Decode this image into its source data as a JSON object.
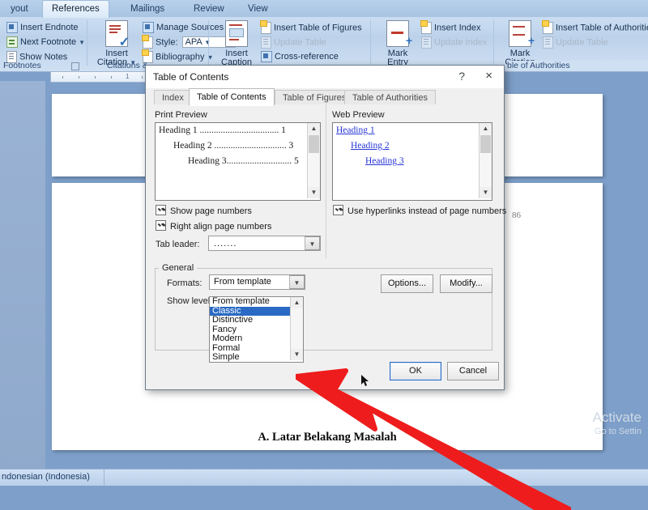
{
  "ribbon": {
    "tabs": [
      {
        "label": "yout",
        "active": false
      },
      {
        "label": "References",
        "active": true
      },
      {
        "label": "Mailings",
        "active": false
      },
      {
        "label": "Review",
        "active": false
      },
      {
        "label": "View",
        "active": false
      }
    ],
    "groups": [
      {
        "name": "Footnotes",
        "label": "Footnotes",
        "items": [
          "Insert Endnote",
          "Next Footnote",
          "Show Notes"
        ]
      },
      {
        "name": "Citations & Bibliography",
        "label": "Citations &",
        "big": "Insert\nCitation",
        "big_line1": "Insert",
        "big_line2": "Citation",
        "items": [
          "Manage Sources",
          "Style:",
          "Bibliography"
        ],
        "style_value": "APA"
      },
      {
        "name": "Captions",
        "label": "",
        "big_line1": "Insert",
        "big_line2": "Caption",
        "items": [
          "Insert Table of Figures",
          "Update Table",
          "Cross-reference"
        ]
      },
      {
        "name": "Index",
        "label": "",
        "big_line1": "Mark",
        "big_line2": "Entry",
        "items": [
          "Insert Index",
          "Update Index"
        ]
      },
      {
        "name": "Table of Authorities",
        "label": "ble of Authorities",
        "big_line1": "Mark",
        "big_line2": "Citation",
        "items": [
          "Insert Table of Authorities",
          "Update Table"
        ]
      }
    ],
    "ruler_marker": "1"
  },
  "document": {
    "page_number": "86",
    "heading": "A. Latar Belakang Masalah"
  },
  "watermark": {
    "line1": "Activate",
    "line2": "Go to Settin"
  },
  "status_bar": {
    "language": "ndonesian (Indonesia)"
  },
  "dialog": {
    "title": "Table of Contents",
    "help_icon": "?",
    "close_icon": "×",
    "tabs": [
      {
        "label": "Index",
        "selected": false
      },
      {
        "label": "Table of Contents",
        "selected": true
      },
      {
        "label": "Table of Figures",
        "selected": false
      },
      {
        "label": "Table of Authorities",
        "selected": false
      }
    ],
    "print_preview": {
      "label": "Print Preview",
      "entries": [
        {
          "text": "Heading 1 ..................................",
          "page": "1"
        },
        {
          "text": "Heading 2 ...............................",
          "page": "3"
        },
        {
          "text": "Heading 3............................",
          "page": "5"
        }
      ]
    },
    "web_preview": {
      "label": "Web Preview",
      "entries": [
        "Heading 1",
        "Heading 2",
        "Heading 3"
      ]
    },
    "checkboxes": [
      {
        "label": "Show page numbers",
        "checked": true
      },
      {
        "label": "Right align page numbers",
        "checked": true
      },
      {
        "label": "Use hyperlinks instead of page numbers",
        "checked": true
      }
    ],
    "tab_leader": {
      "label": "Tab leader:",
      "value": "......."
    },
    "general": {
      "legend": "General",
      "formats_label": "Formats:",
      "formats_value": "From template",
      "show_levels_label": "Show levels:",
      "format_options": [
        {
          "label": "From template",
          "selected": false
        },
        {
          "label": "Classic",
          "selected": true
        },
        {
          "label": "Distinctive",
          "selected": false
        },
        {
          "label": "Fancy",
          "selected": false
        },
        {
          "label": "Modern",
          "selected": false
        },
        {
          "label": "Formal",
          "selected": false
        },
        {
          "label": "Simple",
          "selected": false
        }
      ]
    },
    "buttons": {
      "options": "Options...",
      "modify": "Modify...",
      "ok": "OK",
      "cancel": "Cancel"
    }
  },
  "colors": {
    "accent": "#2a6ac4",
    "arrow": "#ee1c1c",
    "link": "#2735d6",
    "desktop": "#7d9fc9"
  }
}
